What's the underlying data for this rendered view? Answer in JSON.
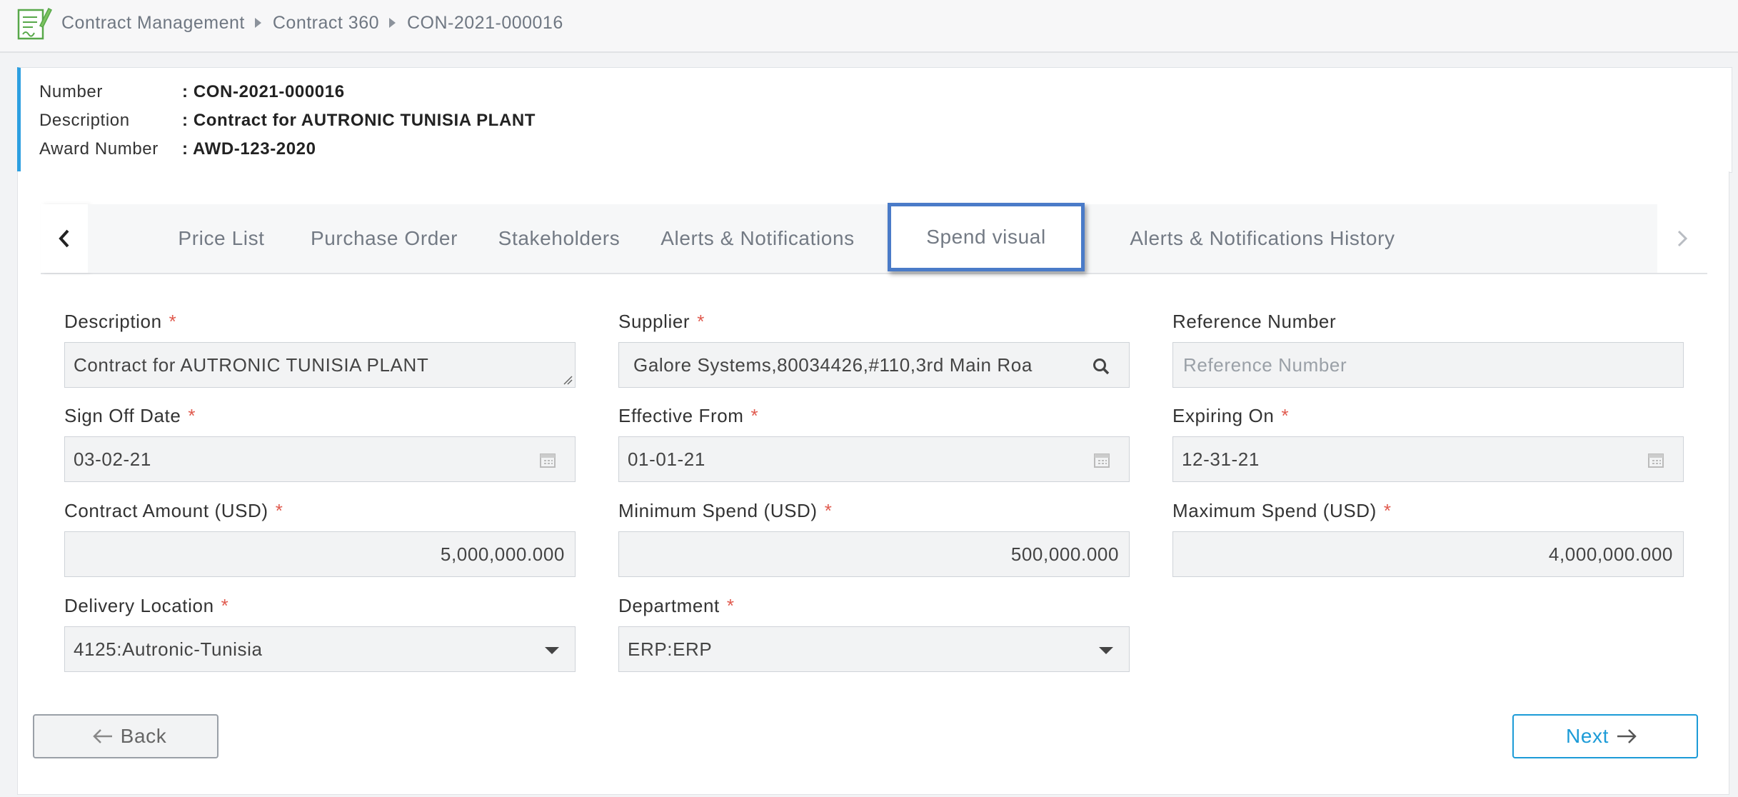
{
  "breadcrumb": [
    "Contract Management",
    "Contract 360",
    "CON-2021-000016"
  ],
  "info": {
    "number_label": "Number",
    "number_value": ": CON-2021-000016",
    "description_label": "Description",
    "description_value": ": Contract for AUTRONIC TUNISIA PLANT",
    "award_label": "Award Number",
    "award_value": ": AWD-123-2020"
  },
  "tabs": [
    {
      "label": "Price List"
    },
    {
      "label": "Purchase Order"
    },
    {
      "label": "Stakeholders"
    },
    {
      "label": "Alerts & Notifications"
    },
    {
      "label": "Spend visual",
      "active": true
    },
    {
      "label": "Alerts & Notifications History"
    }
  ],
  "form": {
    "description": {
      "label": "Description",
      "value": "Contract for AUTRONIC TUNISIA PLANT"
    },
    "supplier": {
      "label": "Supplier",
      "value": "Galore Systems,80034426,#110,3rd Main Roa"
    },
    "reference": {
      "label": "Reference Number",
      "placeholder": "Reference Number"
    },
    "sign_off": {
      "label": "Sign Off Date",
      "value": "03-02-21"
    },
    "effective_from": {
      "label": "Effective From",
      "value": "01-01-21"
    },
    "expiring_on": {
      "label": "Expiring On",
      "value": "12-31-21"
    },
    "contract_amount": {
      "label": "Contract Amount (USD)",
      "value": "5,000,000.000"
    },
    "min_spend": {
      "label": "Minimum Spend (USD)",
      "value": "500,000.000"
    },
    "max_spend": {
      "label": "Maximum Spend (USD)",
      "value": "4,000,000.000"
    },
    "delivery_location": {
      "label": "Delivery Location",
      "value": "4125:Autronic-Tunisia"
    },
    "department": {
      "label": "Department",
      "value": "ERP:ERP"
    },
    "required_mark": "*"
  },
  "buttons": {
    "back": "Back",
    "next": "Next"
  },
  "colors": {
    "accent": "#2d9fe0",
    "active_tab_border": "#4a7bc8",
    "required": "#e05a4e",
    "next_button": "#1c9bd7"
  }
}
